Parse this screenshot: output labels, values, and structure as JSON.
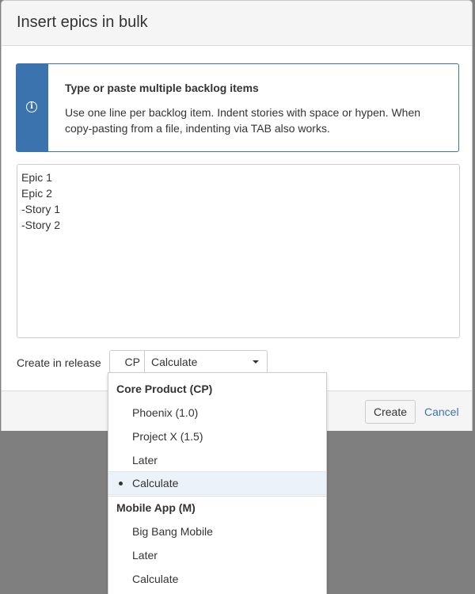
{
  "dialog": {
    "title": "Insert epics in bulk"
  },
  "info": {
    "icon": "info-icon",
    "title": "Type or paste multiple backlog items",
    "text": "Use one line per backlog item. Indent stories with space or hypen. When copy-pasting from a file, indenting via TAB also works."
  },
  "editor": {
    "lines": [
      "Epic 1",
      "Epic 2",
      "-Story 1",
      "-Story 2"
    ]
  },
  "release": {
    "label": "Create in release",
    "code": "CP",
    "value": "Calculate"
  },
  "footer": {
    "create_label": "Create",
    "cancel_label": "Cancel"
  },
  "dropdown": {
    "groups": [
      {
        "heading": "Core Product (CP)",
        "options": [
          "Phoenix (1.0)",
          "Project X (1.5)",
          "Later",
          "Calculate"
        ],
        "selected": "Calculate"
      },
      {
        "heading": "Mobile App (M)",
        "options": [
          "Big Bang Mobile",
          "Later",
          "Calculate"
        ]
      }
    ]
  },
  "colors": {
    "accent": "#3b73af",
    "selected_bg": "#ebf2f9"
  }
}
